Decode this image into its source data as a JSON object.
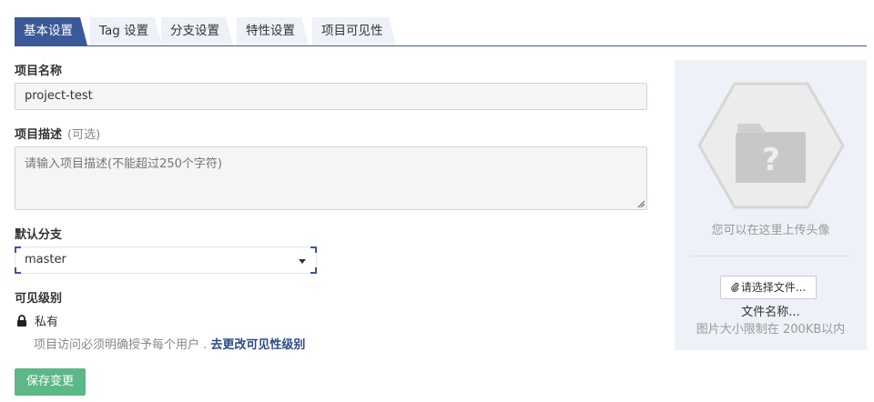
{
  "tabs": [
    {
      "label": "基本设置",
      "active": true
    },
    {
      "label": "Tag 设置",
      "active": false
    },
    {
      "label": "分支设置",
      "active": false
    },
    {
      "label": "特性设置",
      "active": false
    },
    {
      "label": "项目可见性",
      "active": false
    }
  ],
  "form": {
    "name_label": "项目名称",
    "name_value": "project-test",
    "desc_label": "项目描述",
    "desc_optional": "(可选)",
    "desc_placeholder": "请输入项目描述(不能超过250个字符)",
    "branch_label": "默认分支",
    "branch_value": "master",
    "visibility_label": "可见级别",
    "visibility_value": "私有",
    "visibility_note": "项目访问必须明确授予每个用户 . ",
    "visibility_link": "去更改可见性级别",
    "save_label": "保存变更"
  },
  "avatar_panel": {
    "hint": "您可以在这里上传头像",
    "file_button_label": "请选择文件...",
    "file_name": "文件名称...",
    "size_limit": "图片大小限制在 200KB以内"
  },
  "icons": {
    "lock": "lock-icon",
    "attach": "paperclip-icon",
    "placeholder": "folder-question-icon",
    "dropdown": "caret-down-icon"
  },
  "colors": {
    "accent": "#3b5998",
    "tab_inactive": "#eef1f7",
    "save_button": "#5cb887",
    "link": "#2c4a8a"
  }
}
